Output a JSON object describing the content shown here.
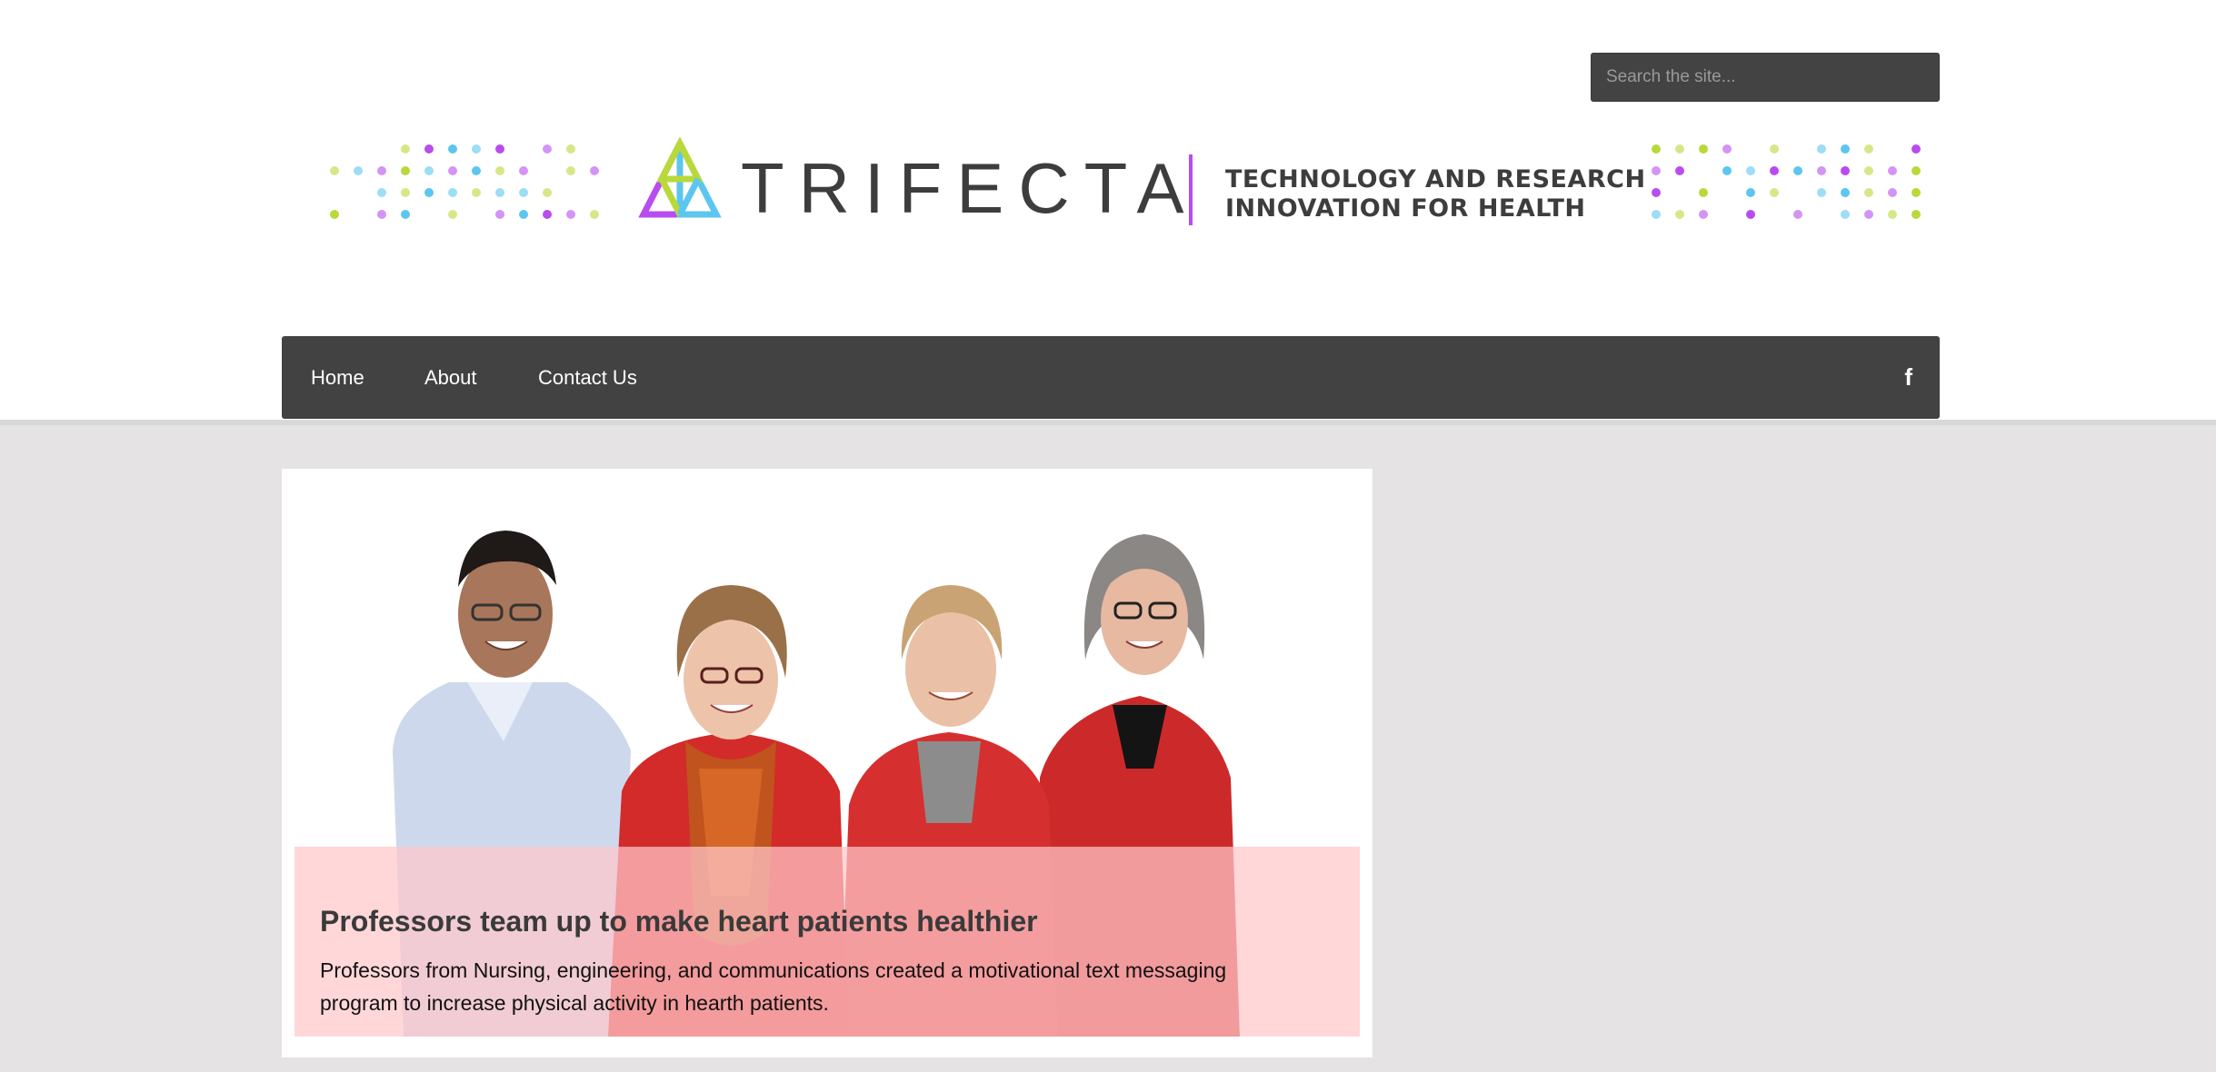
{
  "search": {
    "placeholder": "Search the site..."
  },
  "logo": {
    "wordmark": "TRIFECTA",
    "tagline_line1": "TECHNOLOGY AND RESEARCH",
    "tagline_line2": "INNOVATION FOR HEALTH",
    "colors": {
      "purple": "#b84cf0",
      "lime": "#b9d93a",
      "cyan": "#5cc6ee",
      "text": "#3d3d3d"
    }
  },
  "nav": {
    "items": [
      {
        "label": "Home"
      },
      {
        "label": "About"
      },
      {
        "label": "Contact Us"
      }
    ],
    "social_icon": "facebook-icon",
    "social_glyph": "f"
  },
  "featured": {
    "title": "Professors team up to make heart patients healthier",
    "summary": "Professors from Nursing, engineering, and communications created a motivational text messaging program to increase physical activity in hearth patients."
  },
  "colors": {
    "nav_bg": "#424242",
    "page_bg": "#e5e3e4",
    "caption_overlay": "#ffc8ca"
  }
}
